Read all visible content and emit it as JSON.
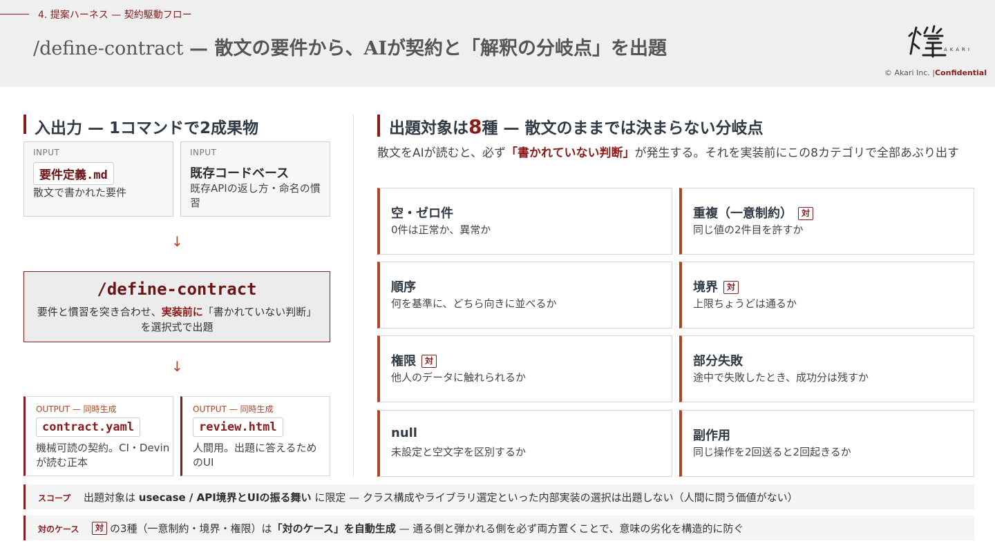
{
  "header": {
    "section_label": "4. 提案ハーネス — 契約駆動フロー",
    "title_command": "/define-contract",
    "title_rest": "— 散文の要件から、AIが契約と「解釈の分岐点」を出題",
    "logo_text": "AKARI",
    "copyright": "© Akari Inc. |",
    "confidential": "Confidential"
  },
  "left": {
    "heading": "入出力 — 1コマンドで2成果物",
    "input1": {
      "tag": "INPUT",
      "chip": "要件定義.md",
      "desc": "散文で書かれた要件"
    },
    "input2": {
      "tag": "INPUT",
      "title": "既存コードベース",
      "desc": "既存APIの返し方・命名の慣習"
    },
    "arrow": "↓",
    "command": {
      "name": "/define-contract",
      "desc_pre": "要件と慣習を突き合わせ、",
      "desc_bold": "実装前に",
      "desc_post": "「書かれていない判断」を選択式で出題"
    },
    "output1": {
      "tag": "OUTPUT — 同時生成",
      "chip": "contract.yaml",
      "desc": "機械可読の契約。CI・Devinが読む正本"
    },
    "output2": {
      "tag": "OUTPUT — 同時生成",
      "chip": "review.html",
      "desc": "人間用。出題に答えるためのUI"
    }
  },
  "right": {
    "heading_pre": "出題対象は",
    "heading_num": "8",
    "heading_post": "種 — 散文のままでは決まらない分岐点",
    "intro_pre": "散文をAIが読むと、必ず",
    "intro_bold": "「書かれていない判断」",
    "intro_post": "が発生する。それを実装前にこの8カテゴリで全部あぶり出す",
    "badge": "対",
    "cards": [
      {
        "title": "空・ゼロ件",
        "desc": "0件は正常か、異常か",
        "badge": false
      },
      {
        "title": "重複（一意制約）",
        "desc": "同じ値の2件目を許すか",
        "badge": true
      },
      {
        "title": "順序",
        "desc": "何を基準に、どちら向きに並べるか",
        "badge": false
      },
      {
        "title": "境界",
        "desc": "上限ちょうどは通るか",
        "badge": true
      },
      {
        "title": "権限",
        "desc": "他人のデータに触れられるか",
        "badge": true
      },
      {
        "title": "部分失敗",
        "desc": "途中で失敗したとき、成功分は残すか",
        "badge": false
      },
      {
        "title": "null",
        "desc": "未設定と空文字を区別するか",
        "badge": false
      },
      {
        "title": "副作用",
        "desc": "同じ操作を2回送ると2回起きるか",
        "badge": false
      }
    ]
  },
  "notes": {
    "scope_label": "スコープ",
    "scope_pre": "出題対象は",
    "scope_bold": "usecase / API境界とUIの振る舞い",
    "scope_post": "に限定 — クラス構成やライブラリ選定といった内部実装の選択は出題しない（人間に問う価値がない）",
    "case_label": "対のケース",
    "case_badge": "対",
    "case_pre": "の3種（一意制約・境界・権限）は",
    "case_bold": "「対のケース」を自動生成",
    "case_post": "— 通る側と弾かれる側を必ず両方置くことで、意味の劣化を構造的に防ぐ"
  }
}
